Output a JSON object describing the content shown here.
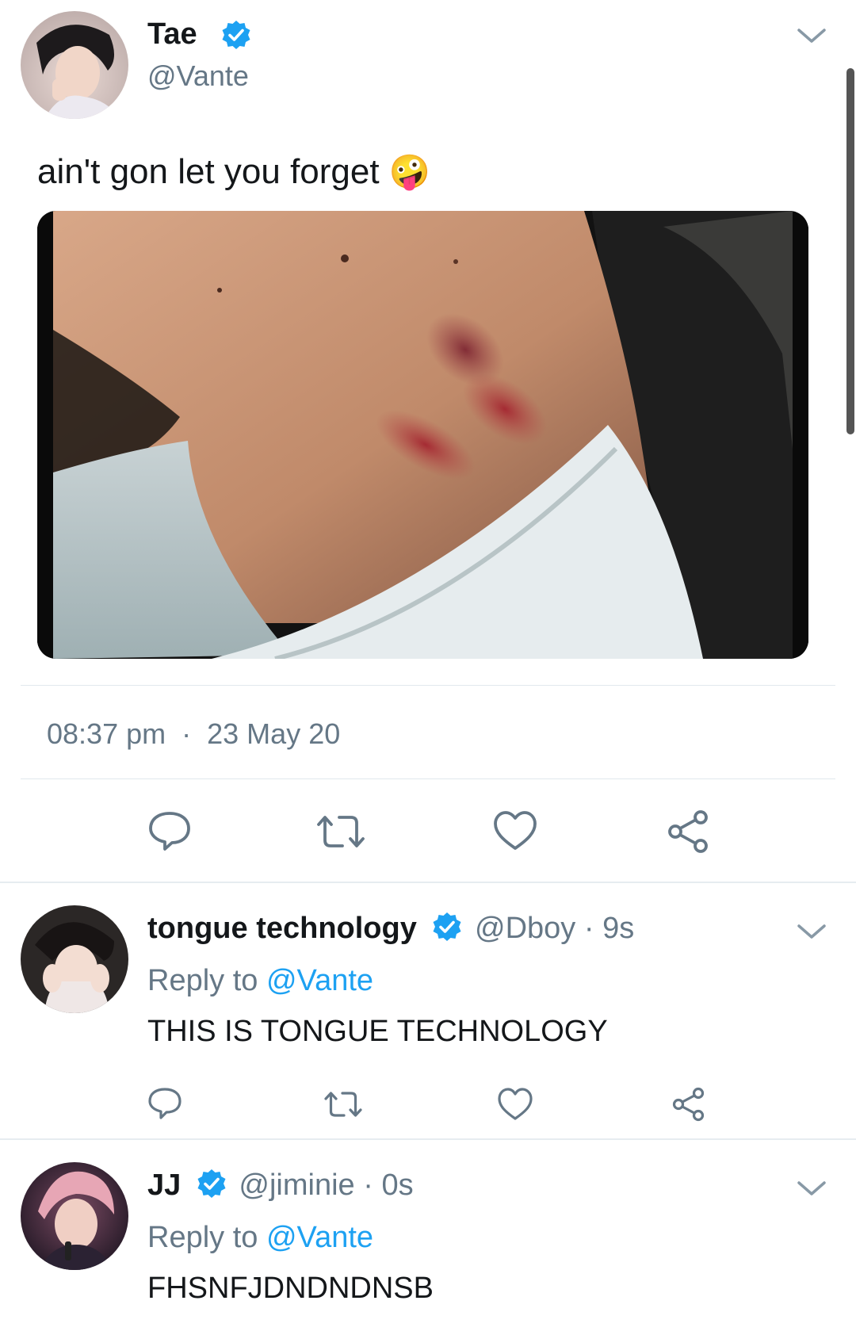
{
  "main_tweet": {
    "display_name": "Tae",
    "handle": "@Vante",
    "text": "ain't gon let you forget",
    "emoji": "🤪",
    "time": "08:37 pm",
    "separator": "·",
    "date": "23 May 20"
  },
  "replies": [
    {
      "display_name": "tongue technology",
      "handle": "@Dboy",
      "age": "· 9s",
      "reply_prefix": "Reply to",
      "reply_target": "@Vante",
      "text": "THIS IS TONGUE TECHNOLOGY"
    },
    {
      "display_name": "JJ",
      "handle": "@jiminie",
      "age": "· 0s",
      "reply_prefix": "Reply to",
      "reply_target": "@Vante",
      "text": "FHSNFJDNDNDNSB"
    }
  ],
  "colors": {
    "accent": "#1da1f2",
    "muted": "#657786",
    "divider": "#e6ecf0"
  },
  "icons": [
    "chevron-down-icon",
    "verified-badge-icon",
    "reply-icon",
    "retweet-icon",
    "like-icon",
    "share-icon"
  ]
}
